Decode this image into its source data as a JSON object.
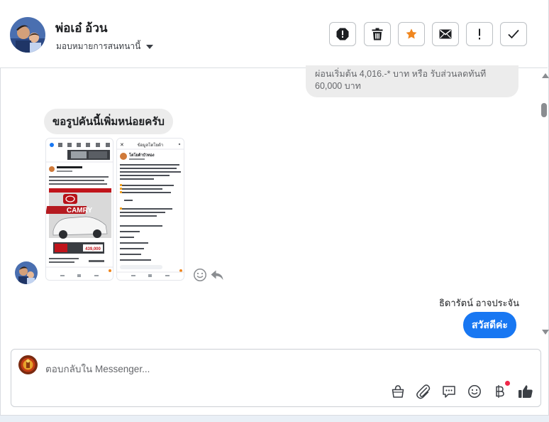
{
  "header": {
    "contact_name": "พ่อเอ๋ อ้วน",
    "assign_label": "มอบหมายการสนทนานี้",
    "actions": [
      "spam-icon",
      "trash-icon",
      "star-icon",
      "mail-icon",
      "exclamation-icon",
      "check-icon"
    ]
  },
  "messages": {
    "prev_preview_line1": "ผ่อนเริ่มต้น 4,016.-* บาท หรือ รับส่วนลดทันที",
    "prev_preview_line2": "60,000 บาท",
    "incoming_text": "ขอรูปคันนี้เพิ่มหน่อยครับ",
    "photo1": {
      "page_title": "โตโยต้า... ",
      "brand_text": "CAMRY",
      "price_text": "439,000"
    },
    "photo2": {
      "page_title": "ข้อมูลโตโยต้า",
      "account_name": "โตโยต้าบัวทอง"
    },
    "outgoing_sender": "ธิดารัตน์ อาจประจัน",
    "outgoing_text": "สวัสดีค่ะ"
  },
  "composer": {
    "placeholder": "ตอบกลับใน Messenger...",
    "icons": [
      "bag-icon",
      "attach-icon",
      "saved-reply-icon",
      "emoji-icon",
      "baht-icon",
      "like-icon"
    ]
  },
  "colors": {
    "accent": "#1877f2",
    "star": "#f0861e",
    "bubble_gray": "#ececec",
    "notification": "#f02849"
  }
}
